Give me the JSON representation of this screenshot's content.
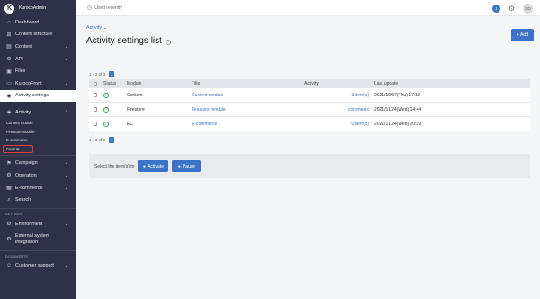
{
  "brand": {
    "name": "KurocoAdmin",
    "logo_letter": "K"
  },
  "sidebar": {
    "items": [
      {
        "label": "Dashboard",
        "icon": "home-icon"
      },
      {
        "label": "Content structure",
        "icon": "structure-icon"
      },
      {
        "label": "Content",
        "icon": "content-icon"
      },
      {
        "label": "API",
        "icon": "api-icon"
      },
      {
        "label": "Files",
        "icon": "files-icon"
      },
      {
        "label": "KurocoFront",
        "icon": "front-icon"
      },
      {
        "label": "Activity settings",
        "icon": "activity-settings-icon"
      },
      {
        "label": "Activity",
        "icon": "activity-icon"
      }
    ],
    "activity_sub": [
      "Content module",
      "Firestore module",
      "E-commerce",
      "Favorite"
    ],
    "items2": [
      {
        "label": "Campaign",
        "icon": "campaign-icon"
      },
      {
        "label": "Operation",
        "icon": "operation-icon"
      },
      {
        "label": "E-commerce",
        "icon": "cart-icon"
      },
      {
        "label": "Search",
        "icon": "search-icon"
      }
    ],
    "settings_label": "SETTINGS",
    "settings_items": [
      {
        "label": "Environment",
        "icon": "environment-icon"
      },
      {
        "label": "External system integration",
        "icon": "integration-icon"
      }
    ],
    "documents_label": "DOCUMENTS",
    "documents_items": [
      {
        "label": "Customer support",
        "icon": "support-icon"
      }
    ]
  },
  "topbar": {
    "recent_label": "Used recently",
    "notification_count": "1",
    "avatar_initials": "SD"
  },
  "main": {
    "breadcrumb": "Activity",
    "title": "Activity settings list",
    "add_label": "+ Add",
    "pager_text": "1 - 3 of 3",
    "page_number": "1",
    "columns": [
      "Status",
      "Module",
      "Title",
      "Activity",
      "Last update"
    ],
    "rows": [
      {
        "module": "Content",
        "title": "Content module",
        "activity": "3 item(s)",
        "last_update": "2021/10/07(Thu) 17:18"
      },
      {
        "module": "Firestore",
        "title": "Firestore module",
        "activity": "comments",
        "last_update": "2021/11/24(Wed) 14:44"
      },
      {
        "module": "EC",
        "title": "E-commerce",
        "activity": "0 item(s)",
        "last_update": "2021/11/24(Wed) 20:39"
      }
    ],
    "action_text": "Select the item(s) to",
    "activate_label": "Activate",
    "pause_label": "Pause"
  },
  "colors": {
    "sidebar_bg": "#2f3148",
    "accent": "#3c73c8",
    "status_ok": "#3aa655",
    "highlight": "#e43c3c"
  }
}
